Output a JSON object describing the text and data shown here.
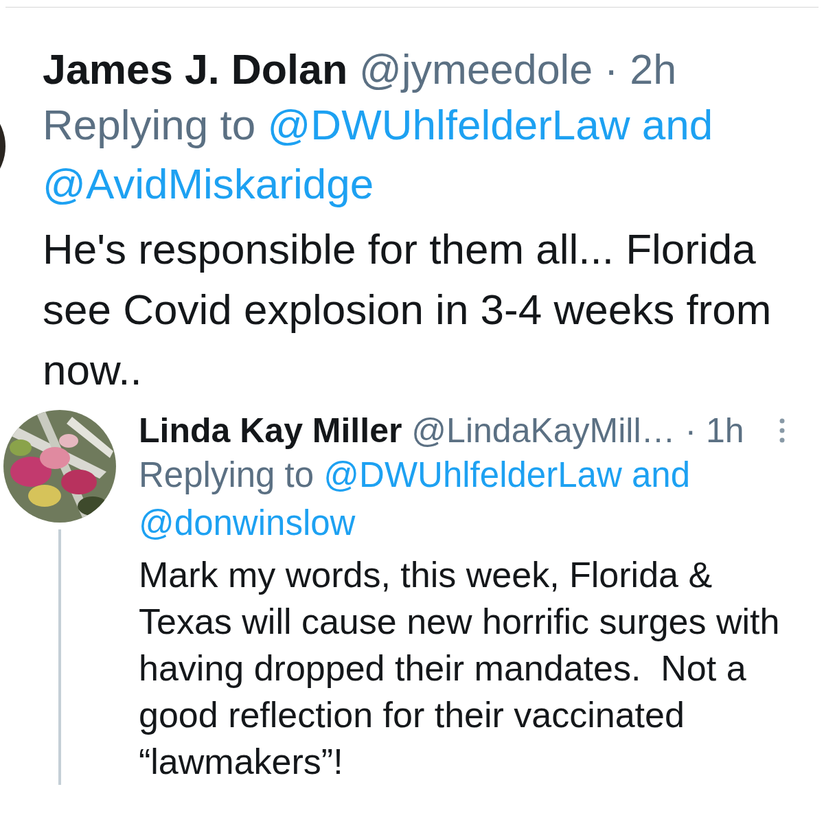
{
  "tweets": [
    {
      "kind": "parent",
      "name": "James J. Dolan",
      "handle": "@jymeedole",
      "separator": "·",
      "time": "2h",
      "menu": false,
      "replying_to": {
        "label": "Replying to",
        "mentions": [
          "@DWUhlfelderLaw",
          "@AvidMiskaridge"
        ],
        "joiner": "and"
      },
      "body": "He's responsible for them all... Florida see Covid explosion in 3-4 weeks from now.."
    },
    {
      "kind": "reply",
      "name": "Linda Kay Miller",
      "handle": "@LindaKayMill…",
      "separator": "·",
      "time": "1h",
      "menu": true,
      "replying_to": {
        "label": "Replying to",
        "mentions": [
          "@DWUhlfelderLaw",
          "@donwinslow"
        ],
        "joiner": "and"
      },
      "body": "Mark my words, this week, Florida & Texas will cause new horrific surges with having dropped their mandates.  Not a good reflection for their vaccinated “lawmakers”!"
    }
  ]
}
